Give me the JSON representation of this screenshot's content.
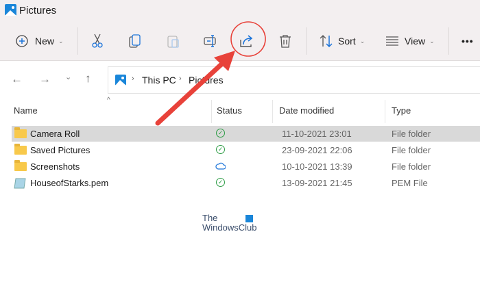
{
  "window": {
    "title": "Pictures"
  },
  "toolbar": {
    "new_label": "New",
    "sort_label": "Sort",
    "view_label": "View",
    "more_label": "•••"
  },
  "address": {
    "crumbs": [
      "This PC",
      "Pictures"
    ]
  },
  "columns": [
    "Name",
    "Status",
    "Date modified",
    "Type"
  ],
  "files": [
    {
      "name": "Camera Roll",
      "status": "synced",
      "date": "11-10-2021 23:01",
      "type": "File folder",
      "kind": "folder"
    },
    {
      "name": "Saved Pictures",
      "status": "synced",
      "date": "23-09-2021 22:06",
      "type": "File folder",
      "kind": "folder"
    },
    {
      "name": "Screenshots",
      "status": "cloud",
      "date": "10-10-2021 13:39",
      "type": "File folder",
      "kind": "folder"
    },
    {
      "name": "HouseofStarks.pem",
      "status": "synced",
      "date": "13-09-2021 21:45",
      "type": "PEM File",
      "kind": "file"
    }
  ],
  "watermark": {
    "line1": "The",
    "line2": "WindowsClub"
  },
  "colors": {
    "accent": "#1a73d9",
    "annotation": "#e8423a",
    "selection": "#d9d9d9"
  }
}
